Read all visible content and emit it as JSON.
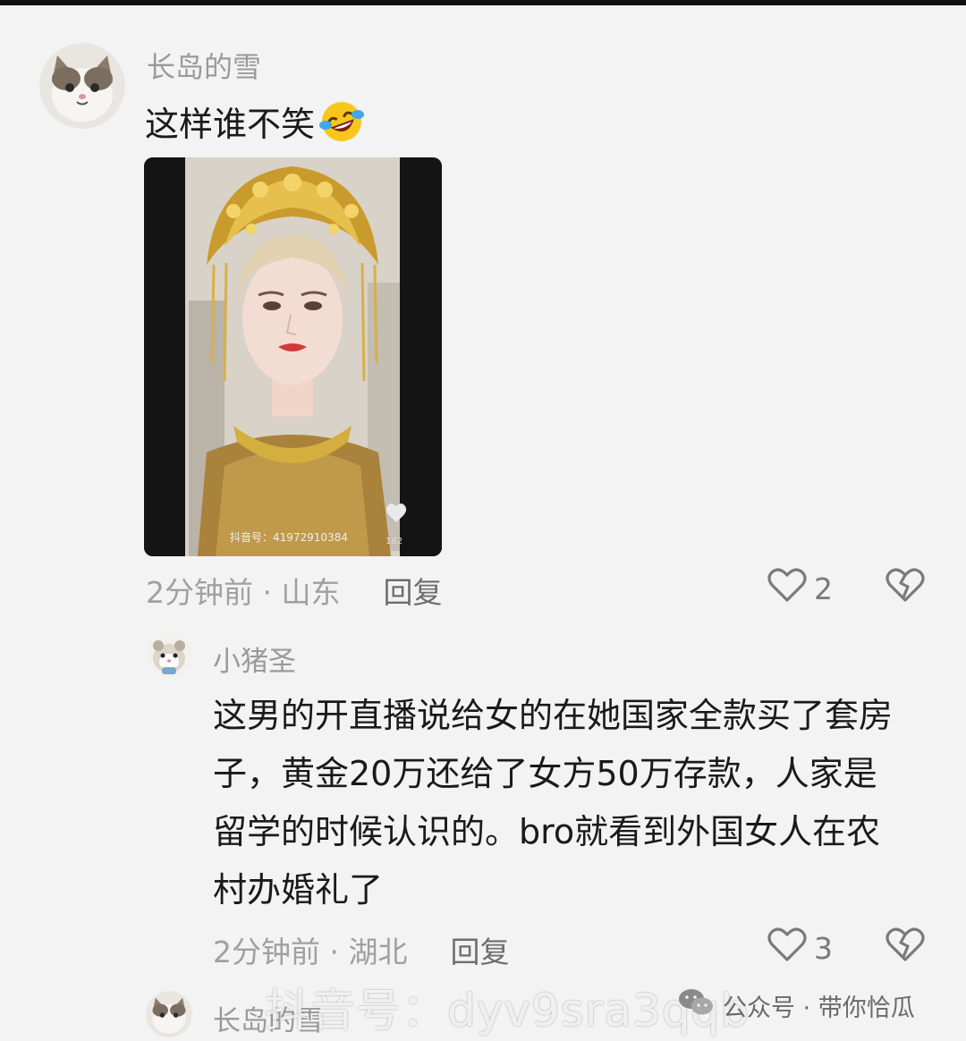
{
  "comment1": {
    "username": "长岛的雪",
    "text": "这样谁不笑",
    "emoji_icon": "laughing-tears-emoji",
    "video": {
      "platform_label": "抖音号：41972910384",
      "like_count": "182"
    },
    "time_location": "2分钟前 · 山东",
    "reply_label": "回复",
    "like_count": "2"
  },
  "comment2": {
    "username": "小猪圣",
    "lines": [
      "这男的开直播说给女的在她国家全款买了套房",
      "子，黄金20万还给了女方50万存款，人家是",
      "留学的时候认识的。bro就看到外国女人在农",
      "村办婚礼了"
    ],
    "time_location": "2分钟前 · 湖北",
    "reply_label": "回复",
    "like_count": "3"
  },
  "comment3": {
    "username": "长岛的雪"
  },
  "watermark": {
    "douyin": "抖音号：dyv9sra3qqb",
    "wechat": "公众号 · 带你恰瓜"
  },
  "colors": {
    "background": "#f3f3f3",
    "text": "#1a1a1a",
    "muted": "#9a9a9a"
  }
}
